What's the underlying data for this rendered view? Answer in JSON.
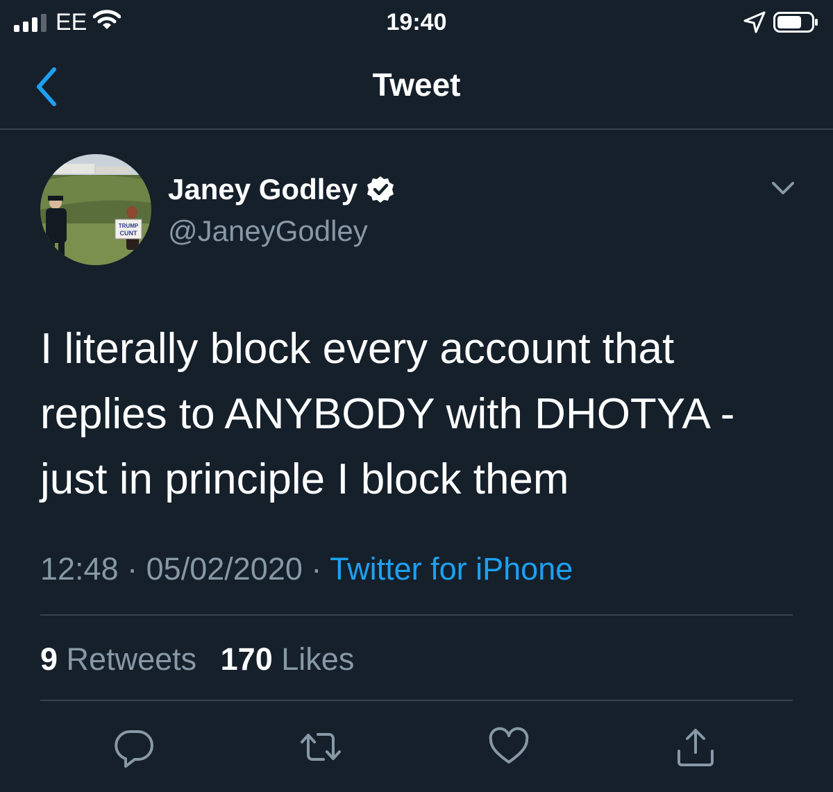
{
  "status_bar": {
    "carrier": "EE",
    "time": "19:40",
    "signal_icon": "cellular-signal-icon",
    "wifi_icon": "wifi-icon",
    "location_icon": "location-arrow-icon",
    "battery_icon": "battery-icon"
  },
  "header": {
    "title": "Tweet",
    "back_icon": "chevron-left-icon"
  },
  "tweet": {
    "author": {
      "name": "Janey Godley",
      "handle": "@JaneyGodley",
      "verified": true,
      "avatar_sign_text": [
        "TRUMP",
        "CUNT"
      ]
    },
    "text_lines": [
      "I literally block every account that",
      "replies to ANYBODY with DHOTYA -",
      "just in principle I block them"
    ],
    "time": "12:48",
    "separator": "·",
    "date": "05/02/2020",
    "source": "Twitter for iPhone",
    "stats": {
      "retweets_count": "9",
      "retweets_label": "Retweets",
      "likes_count": "170",
      "likes_label": "Likes"
    },
    "actions": [
      "reply-icon",
      "retweet-icon",
      "like-icon",
      "share-icon"
    ]
  },
  "colors": {
    "background": "#15202b",
    "divider": "#38444d",
    "secondary_text": "#8899a6",
    "accent": "#1da1f2"
  }
}
